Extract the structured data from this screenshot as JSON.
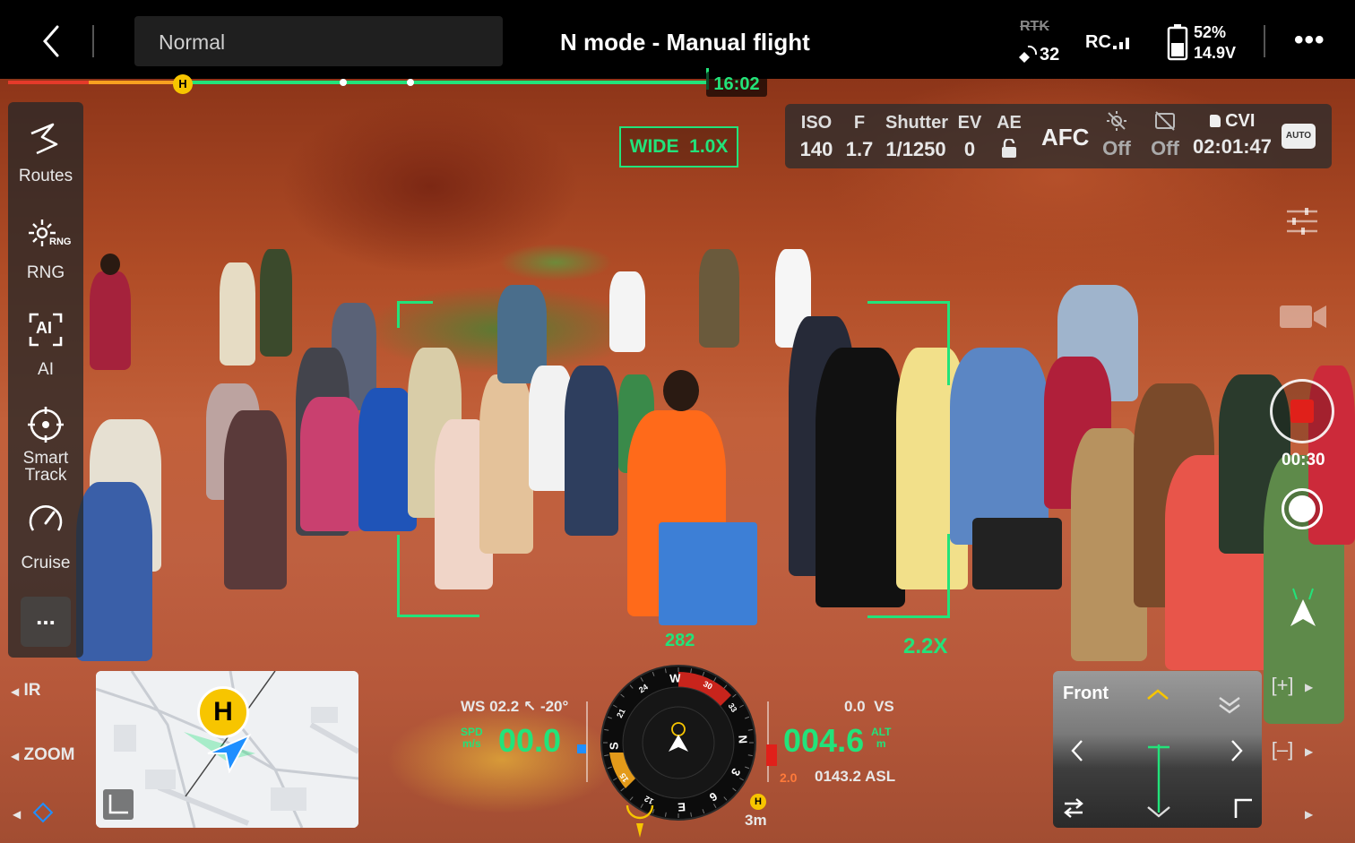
{
  "topbar": {
    "back_icon": "chevron-left-icon",
    "mode_select": "Normal",
    "title": "N mode - Manual flight",
    "rtk_label": "RTK",
    "satellites": "32",
    "rc_label": "RC",
    "battery_percent": "52%",
    "battery_voltage": "14.9V",
    "more_icon": "ellipsis-icon"
  },
  "progress": {
    "home_marker": "H",
    "flight_time": "16:02"
  },
  "sidebar": {
    "items": [
      {
        "label": "Routes",
        "icon": "routes-icon"
      },
      {
        "label": "RNG",
        "icon": "rng-icon",
        "badge": "RNG"
      },
      {
        "label": "AI",
        "icon": "ai-icon",
        "badge": "AI"
      },
      {
        "label": "Smart Track",
        "line1": "Smart",
        "line2": "Track",
        "icon": "smart-track-icon"
      },
      {
        "label": "Cruise",
        "icon": "cruise-icon"
      }
    ],
    "more": "...",
    "ir_label": "IR",
    "zoom_label": "ZOOM"
  },
  "camera": {
    "lens_zoom": "WIDE  1.0X",
    "iso_label": "ISO",
    "iso_value": "140",
    "f_label": "F",
    "f_value": "1.7",
    "shutter_label": "Shutter",
    "shutter_value": "1/1250",
    "ev_label": "EV",
    "ev_value": "0",
    "ae_label": "AE",
    "focus_mode": "AFC",
    "setting1_value": "Off",
    "setting2_value": "Off",
    "storage_label": "CVI",
    "remaining_time": "02:01:47",
    "auto_label": "AUTO",
    "record_time": "00:30",
    "target_zoom": "2.2X"
  },
  "telemetry": {
    "heading": "282",
    "ws_label": "WS",
    "ws_value": "02.2",
    "ws_dir": "↖",
    "ws_angle": "-20°",
    "spd_label": "SPD",
    "spd_unit": "m/s",
    "spd_value": "00.0",
    "vs_value": "0.0",
    "vs_label": "VS",
    "alt_value": "004.6",
    "alt_label": "ALT",
    "alt_unit": "m",
    "asl_value": "0143.2 ASL",
    "sub_value": "2.0",
    "home_dist": "3m",
    "compass": [
      "W",
      "30",
      "33",
      "N",
      "3",
      "6",
      "E",
      "12",
      "15",
      "S",
      "21",
      "24"
    ]
  },
  "fpv": {
    "label": "Front"
  },
  "colors": {
    "accent": "#22e37a",
    "record": "#e0201a",
    "home": "#f7c500",
    "nav": "#1e8fff"
  }
}
